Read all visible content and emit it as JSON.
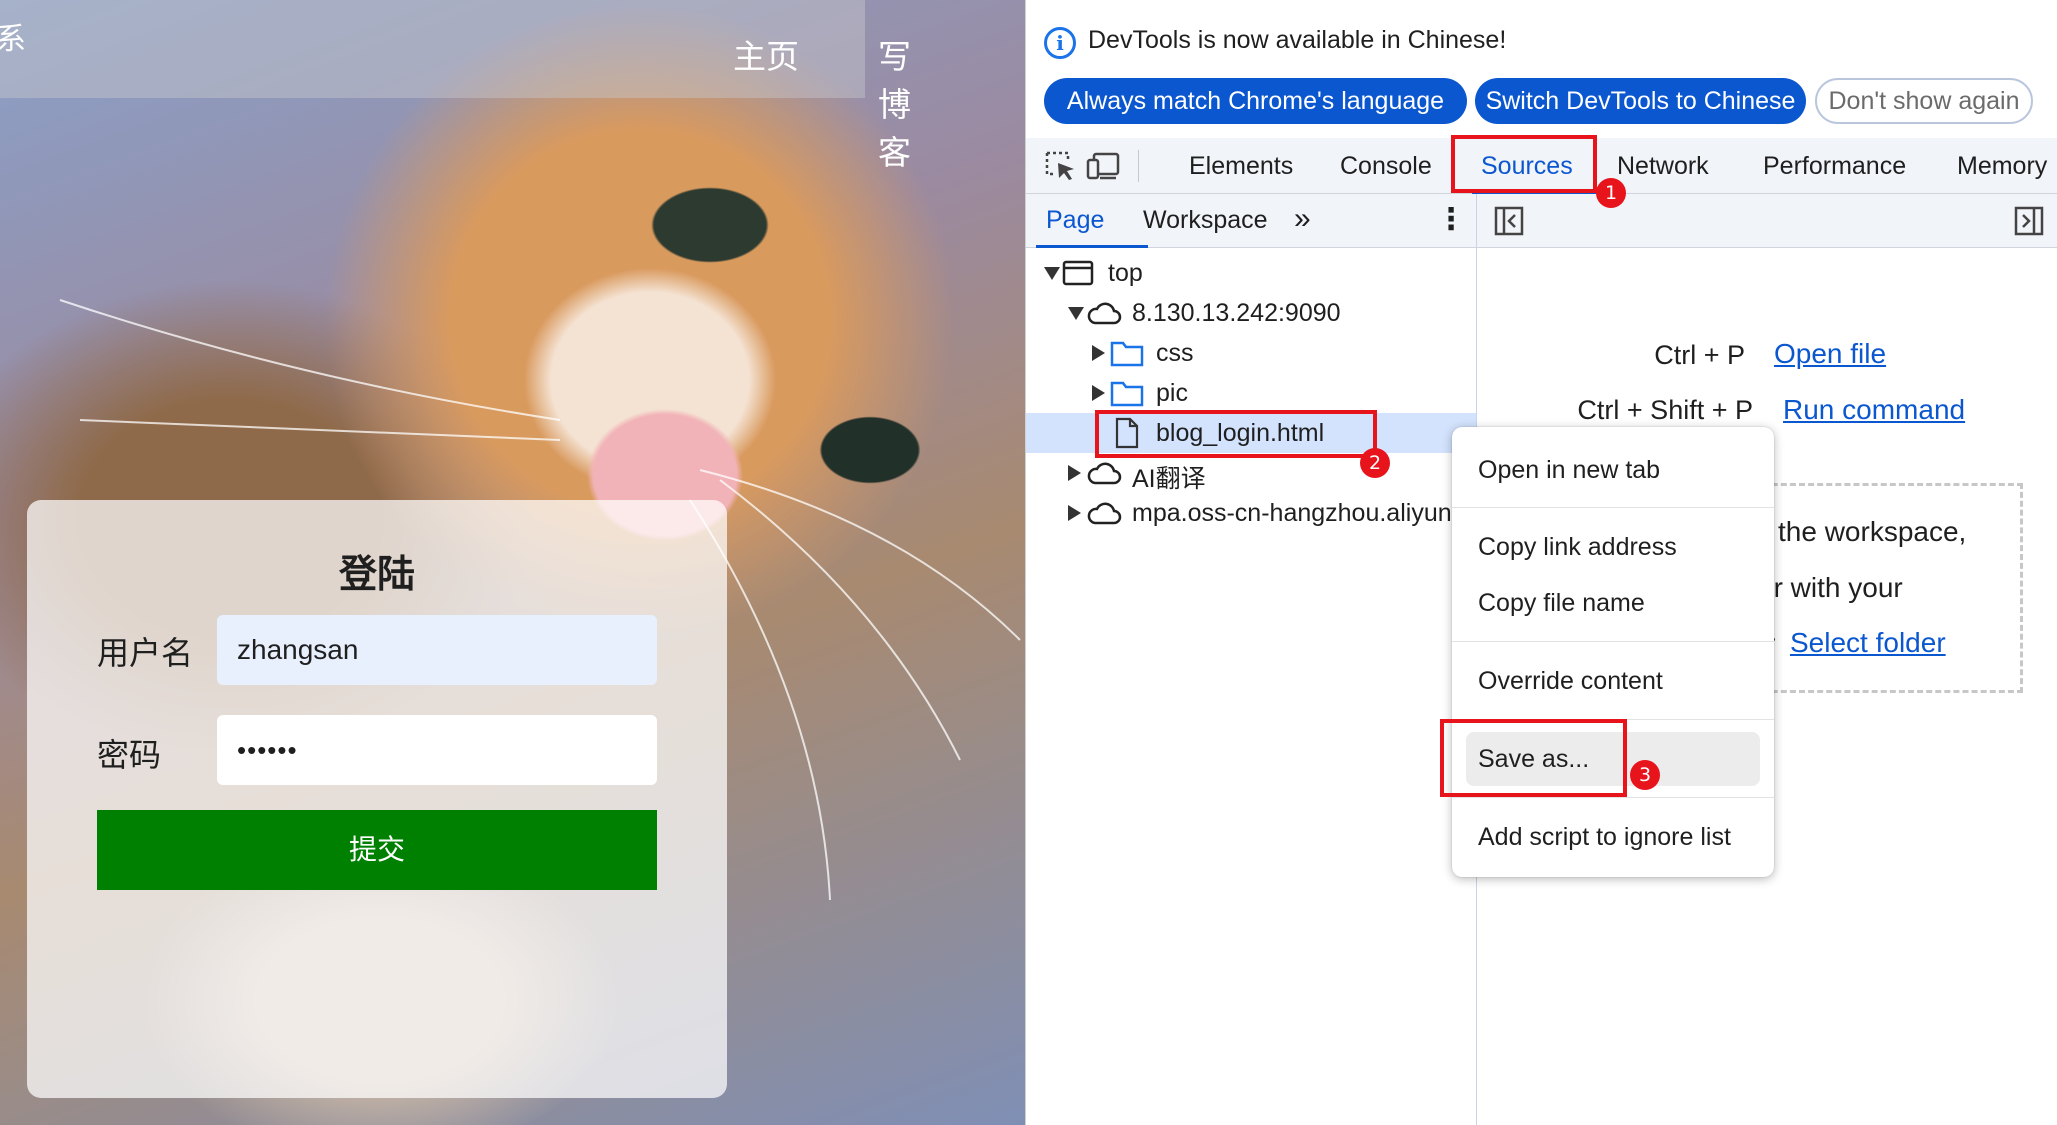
{
  "blog": {
    "nav_edge_char": "系",
    "nav_links": [
      "主页",
      "写博客"
    ],
    "login": {
      "title": "登陆",
      "username_label": "用户名",
      "username_value": "zhangsan",
      "password_label": "密码",
      "password_value": "••••••",
      "submit_label": "提交"
    }
  },
  "devtools": {
    "infobar": {
      "message": "DevTools is now available in Chinese!",
      "buttons": [
        "Always match Chrome's language",
        "Switch DevTools to Chinese",
        "Don't show again"
      ]
    },
    "main_tabs": [
      "Elements",
      "Console",
      "Sources",
      "Network",
      "Performance",
      "Memory"
    ],
    "active_tab": "Sources",
    "sub_tabs": [
      "Page",
      "Workspace"
    ],
    "active_sub_tab": "Page",
    "more_tabs_glyph": "»",
    "kebab_glyph": "⋮",
    "tree": [
      {
        "label": "top",
        "level": 0,
        "expanded": true,
        "icon": "frame-icon"
      },
      {
        "label": "8.130.13.242:9090",
        "level": 1,
        "expanded": true,
        "icon": "cloud-icon"
      },
      {
        "label": "css",
        "level": 2,
        "expanded": false,
        "icon": "folder-icon"
      },
      {
        "label": "pic",
        "level": 2,
        "expanded": false,
        "icon": "folder-icon"
      },
      {
        "label": "blog_login.html",
        "level": 2,
        "selected": true,
        "icon": "file-icon"
      },
      {
        "label": "AI翻译",
        "level": 1,
        "expanded": false,
        "icon": "cloud-icon"
      },
      {
        "label": "mpa.oss-cn-hangzhou.aliyun",
        "level": 1,
        "expanded": false,
        "icon": "cloud-icon"
      }
    ],
    "shortcuts": [
      {
        "keys": "Ctrl + P",
        "action": "Open file"
      },
      {
        "keys": "Ctrl + Shift + P",
        "action": "Run command"
      }
    ],
    "workspace": {
      "line1": "the workspace,",
      "line2": "er with your",
      "line3_prefix": "r",
      "link": "Select folder"
    },
    "context_menu": [
      {
        "label": "Open in new tab"
      },
      {
        "label": "Copy link address"
      },
      {
        "label": "Copy file name"
      },
      {
        "label": "Override content"
      },
      {
        "label": "Save as..."
      },
      {
        "label": "Add script to ignore list"
      }
    ],
    "annotations": [
      "1",
      "2",
      "3"
    ],
    "accent_color": "#0b57d0",
    "annotation_color": "#e8141c"
  }
}
